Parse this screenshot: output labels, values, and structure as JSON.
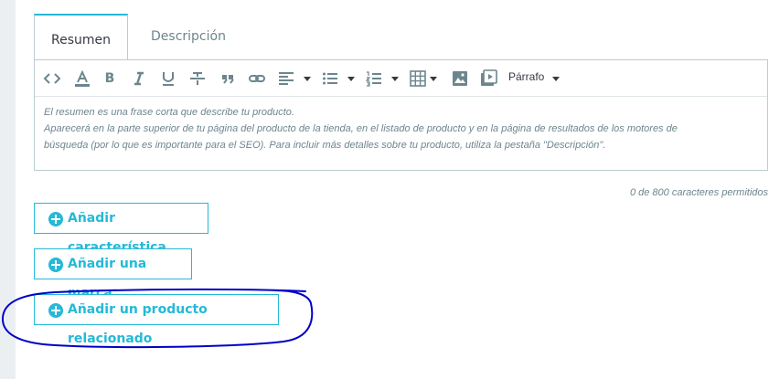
{
  "tabs": [
    {
      "label": "Resumen",
      "active": true
    },
    {
      "label": "Descripción",
      "active": false
    }
  ],
  "toolbar": {
    "icons": [
      "code-icon",
      "font-color-icon",
      "bold-icon",
      "italic-icon",
      "underline-icon",
      "strikethrough-icon",
      "blockquote-icon",
      "link-icon",
      "align-left-icon",
      "bullet-list-icon",
      "numbered-list-icon",
      "table-icon",
      "image-icon",
      "media-icon"
    ],
    "format_label": "Párrafo"
  },
  "editor": {
    "lines": [
      "El resumen es una frase corta que describe tu producto.",
      "Aparecerá en la parte superior de tu página del producto de la tienda, en el listado de producto y en la página de resultados de los motores de",
      "búsqueda (por lo que es importante para el SEO). Para incluir más detalles sobre tu producto, utiliza la pestaña \"Descripción\"."
    ]
  },
  "counter": "0 de 800 caracteres permitidos",
  "buttons": {
    "feature": "Añadir característica",
    "brand": "Añadir una marca",
    "related": "Añadir un producto relacionado"
  },
  "colors": {
    "accent": "#25b9d7",
    "annotation": "#0000c8"
  }
}
